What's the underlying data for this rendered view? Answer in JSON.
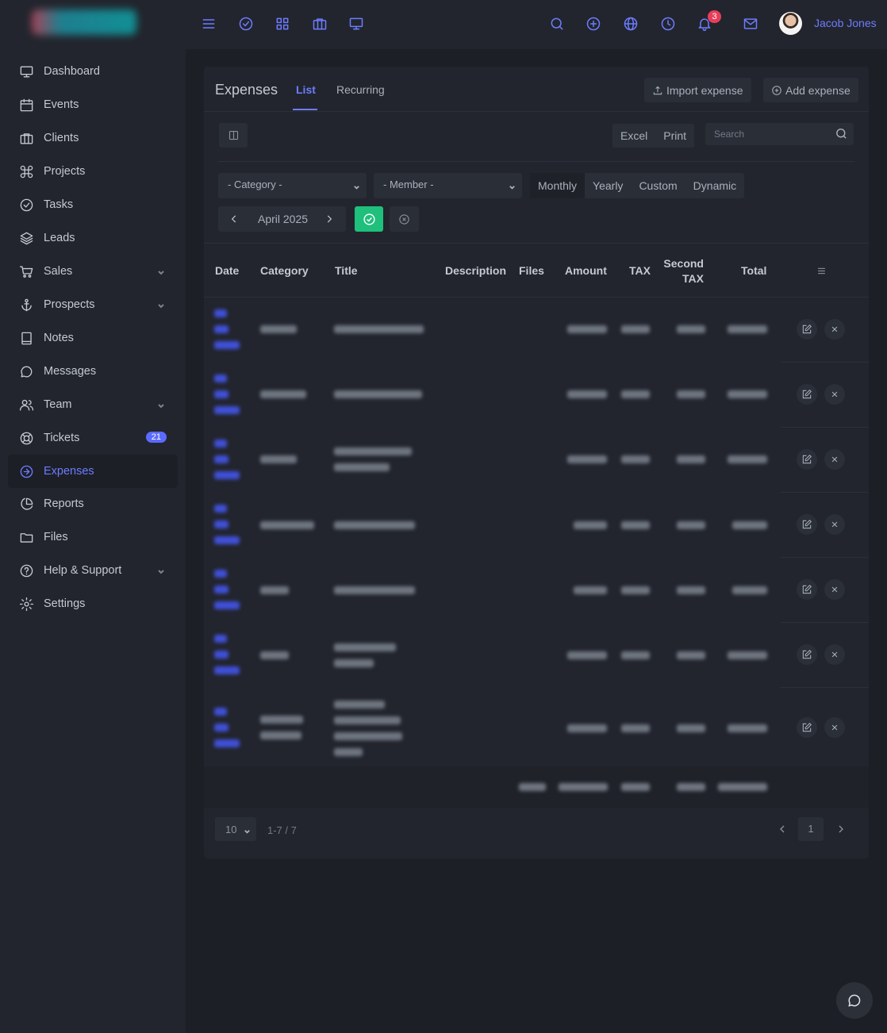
{
  "topbar": {
    "notifications_count": "3",
    "user_name": "Jacob Jones",
    "icons": [
      "menu-icon",
      "check-circle-icon",
      "grid-icon",
      "briefcase-icon",
      "monitor-icon",
      "search-icon",
      "plus-circle-icon",
      "globe-icon",
      "clock-icon",
      "bell-icon",
      "mail-icon"
    ]
  },
  "sidebar": {
    "items": [
      {
        "label": "Dashboard",
        "icon": "monitor-icon"
      },
      {
        "label": "Events",
        "icon": "calendar-icon"
      },
      {
        "label": "Clients",
        "icon": "briefcase-icon"
      },
      {
        "label": "Projects",
        "icon": "command-icon"
      },
      {
        "label": "Tasks",
        "icon": "check-circle-icon"
      },
      {
        "label": "Leads",
        "icon": "layers-icon"
      },
      {
        "label": "Sales",
        "icon": "cart-icon",
        "has_submenu": true
      },
      {
        "label": "Prospects",
        "icon": "anchor-icon",
        "has_submenu": true
      },
      {
        "label": "Notes",
        "icon": "book-icon"
      },
      {
        "label": "Messages",
        "icon": "message-icon"
      },
      {
        "label": "Team",
        "icon": "users-icon",
        "has_submenu": true
      },
      {
        "label": "Tickets",
        "icon": "lifebuoy-icon",
        "badge": "21"
      },
      {
        "label": "Expenses",
        "icon": "arrow-circle-icon",
        "active": true
      },
      {
        "label": "Reports",
        "icon": "pie-chart-icon"
      },
      {
        "label": "Files",
        "icon": "folder-icon"
      },
      {
        "label": "Help & Support",
        "icon": "help-circle-icon",
        "has_submenu": true
      },
      {
        "label": "Settings",
        "icon": "gear-icon"
      }
    ]
  },
  "page": {
    "title": "Expenses",
    "tabs": [
      "List",
      "Recurring"
    ],
    "active_tab": "List",
    "import_label": "Import expense",
    "add_label": "Add expense"
  },
  "toolbar": {
    "excel_label": "Excel",
    "print_label": "Print",
    "search_placeholder": "Search"
  },
  "filters": {
    "category_select": "- Category -",
    "member_select": "- Member -",
    "period_options": [
      "Monthly",
      "Yearly",
      "Custom",
      "Dynamic"
    ],
    "active_period": "Monthly",
    "current_month": "April 2025"
  },
  "table": {
    "columns": [
      "Date",
      "Category",
      "Title",
      "Description",
      "Files",
      "Amount",
      "TAX",
      "Second TAX",
      "Total"
    ],
    "row_count": 7
  },
  "pagination": {
    "page_size": "10",
    "range": "1-7 / 7",
    "current_page": "1"
  },
  "colors": {
    "accent": "#6d7cff",
    "success": "#1fbf7c",
    "badge": "#e83e5a",
    "background": "#1c1f26",
    "panel": "#22252d"
  }
}
